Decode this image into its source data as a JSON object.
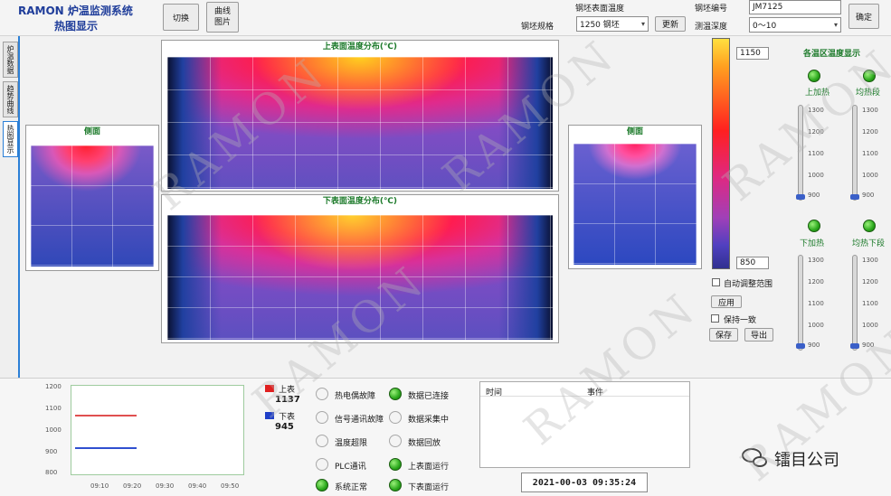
{
  "header": {
    "logo_line1": "RAMON 炉温监测系统",
    "logo_line2": "热图显示",
    "btn_switch": "切换",
    "btn_chart_top": "曲线",
    "btn_chart_bottom": "图片",
    "label_surface": "钢坯表面温度",
    "label_preset": "钢坯规格",
    "preset_value": "1250 钢坯",
    "btn_update": "更新",
    "label_steel": "钢坯编号",
    "steel_value": "JM7125",
    "label_depth": "测温深度",
    "depth_value": "0～10",
    "btn_confirm": "确定"
  },
  "tabs": [
    {
      "label": "炉温数据"
    },
    {
      "label": "趋势曲线"
    },
    {
      "label": "热图显示"
    }
  ],
  "panels": {
    "top_title": "上表面温度分布(℃)",
    "bottom_title": "下表面温度分布(℃)",
    "left_title": "侧面",
    "right_title": "侧面"
  },
  "colorbar": {
    "max_value": "1150",
    "min_value": "850",
    "auto_scale_label": "自动调整范围",
    "btn_apply": "应用",
    "lock_label": "保持一致",
    "btn_save": "保存",
    "btn_export": "导出"
  },
  "zones": {
    "title": "各温区温度显示",
    "items": [
      {
        "label": "上加热",
        "ticks": [
          "1300",
          "1200",
          "1100",
          "1000",
          "900"
        ]
      },
      {
        "label": "均热段",
        "ticks": [
          "1300",
          "1200",
          "1100",
          "1000",
          "900"
        ]
      },
      {
        "label": "下加热",
        "ticks": [
          "1300",
          "1200",
          "1100",
          "1000",
          "900"
        ]
      },
      {
        "label": "均热下段",
        "ticks": [
          "1300",
          "1200",
          "1100",
          "1000",
          "900"
        ]
      }
    ]
  },
  "trend": {
    "y_ticks": [
      "1200",
      "1100",
      "1000",
      "900",
      "800"
    ],
    "x_ticks": [
      "09:10",
      "09:20",
      "09:30",
      "09:40",
      "09:50"
    ],
    "legend": [
      {
        "name": "上表",
        "value": "1137",
        "color": "#e02020"
      },
      {
        "name": "下表",
        "value": "945",
        "color": "#2040c8"
      }
    ],
    "colors": {
      "upper": "#e05050",
      "lower": "#3050d0"
    }
  },
  "status": {
    "col1": [
      {
        "label": "热电偶故障",
        "on": false
      },
      {
        "label": "信号通讯故障",
        "on": false
      },
      {
        "label": "温度超限",
        "on": false
      },
      {
        "label": "PLC通讯",
        "on": false
      },
      {
        "label": "系统正常",
        "on": true
      }
    ],
    "col2": [
      {
        "label": "数据已连接",
        "on": true
      },
      {
        "label": "数据采集中",
        "on": false
      },
      {
        "label": "数据回放",
        "on": false
      },
      {
        "label": "上表面运行",
        "on": true
      },
      {
        "label": "下表面运行",
        "on": true
      }
    ]
  },
  "events": {
    "col_time": "时间",
    "col_event": "事件"
  },
  "clock": "2021-00-03 09:35:24",
  "watermark_text": "RAMON",
  "brand": {
    "name": "镭目公司",
    "icon": "wechat-icon"
  }
}
